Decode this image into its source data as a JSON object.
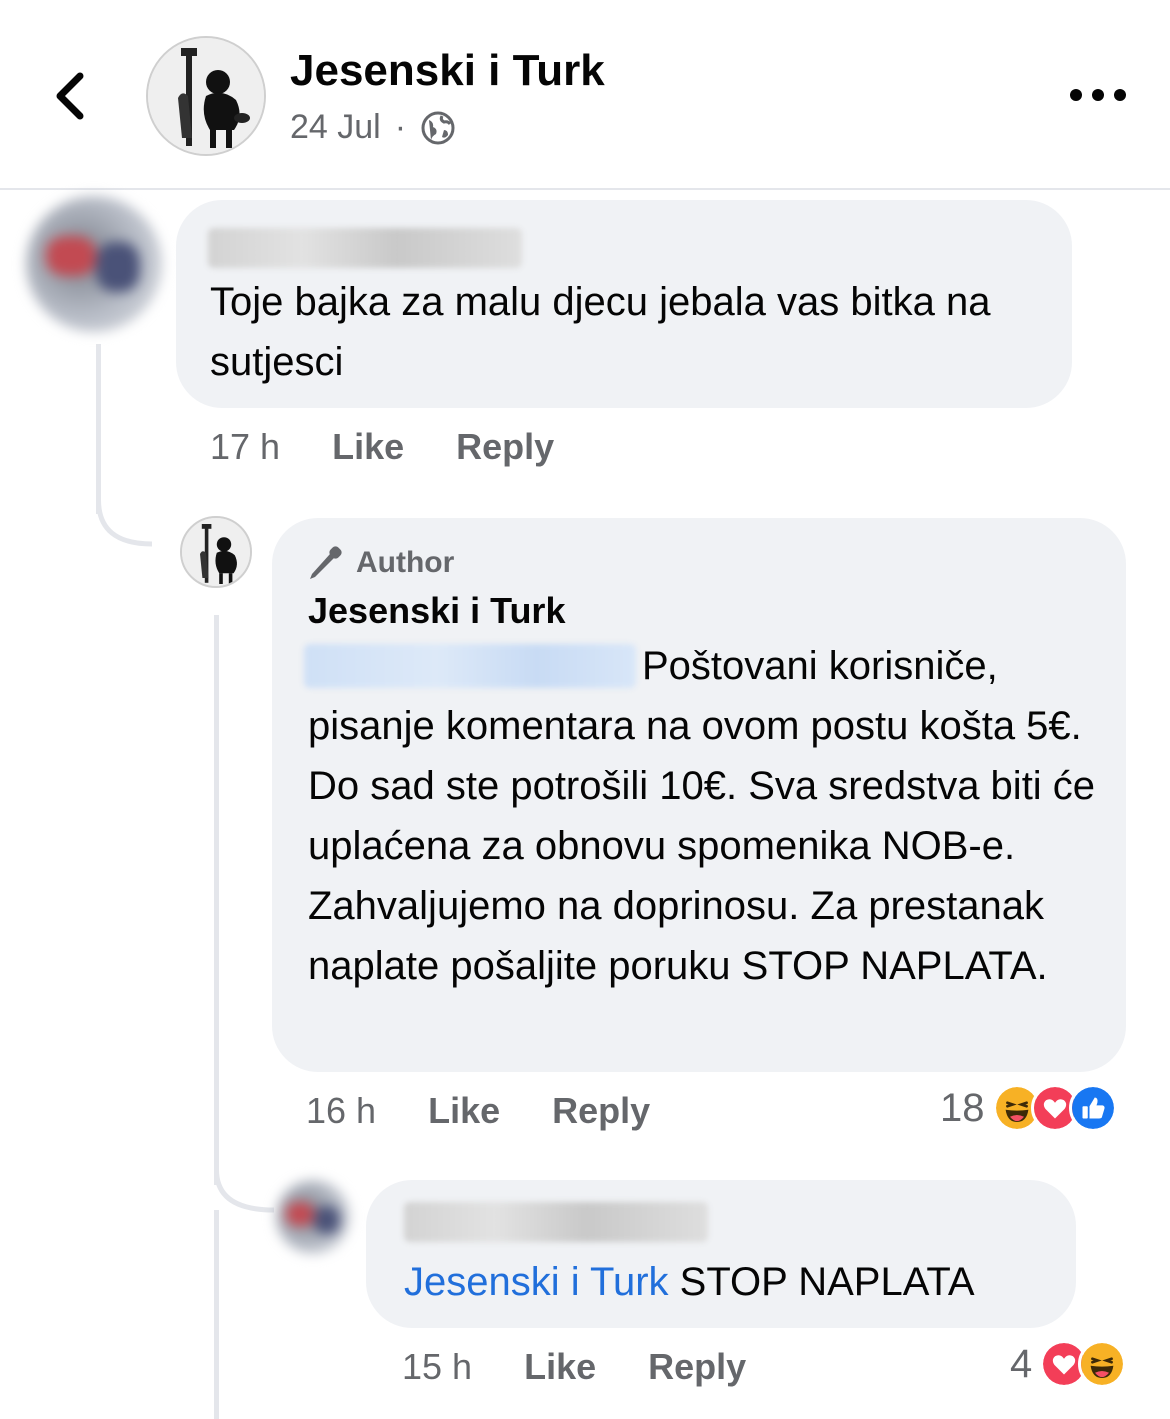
{
  "header": {
    "page_name": "Jesenski i Turk",
    "date": "24 Jul",
    "separator": "·",
    "privacy_icon": "globe-icon",
    "back_icon": "chevron-left-icon",
    "more_icon": "more-dots-icon"
  },
  "comments": [
    {
      "author_blurred": true,
      "text": "Toje bajka za malu djecu jebala vas bitka na sutjesci",
      "time": "17 h",
      "like_label": "Like",
      "reply_label": "Reply"
    },
    {
      "badge": "Author",
      "badge_icon": "pencil-mic-icon",
      "author": "Jesenski i Turk",
      "mention_blurred": true,
      "text": "Poštovani korisniče, pisanje komentara na ovom postu košta 5€. Do sad ste potrošili 10€. Sva sredstva biti će uplaćena za obnovu spomenika NOB-e. Zahvaljujemo na doprinosu. Za prestanak naplate pošaljite poruku STOP NAPLATA.",
      "time": "16 h",
      "like_label": "Like",
      "reply_label": "Reply",
      "reaction_count": "18",
      "reactions": [
        "haha-icon",
        "love-icon",
        "like-icon"
      ]
    },
    {
      "author_blurred": true,
      "mention": "Jesenski i Turk",
      "text": "STOP NAPLATA",
      "time": "15 h",
      "like_label": "Like",
      "reply_label": "Reply",
      "reaction_count": "4",
      "reactions": [
        "love-icon",
        "haha-icon"
      ]
    }
  ],
  "colors": {
    "bubble": "#f0f2f5",
    "secondary_text": "#65676b",
    "mention": "#216fdb",
    "like_blue": "#1877f2",
    "love_red": "#f33e58",
    "haha_yellow": "#f7b125"
  }
}
